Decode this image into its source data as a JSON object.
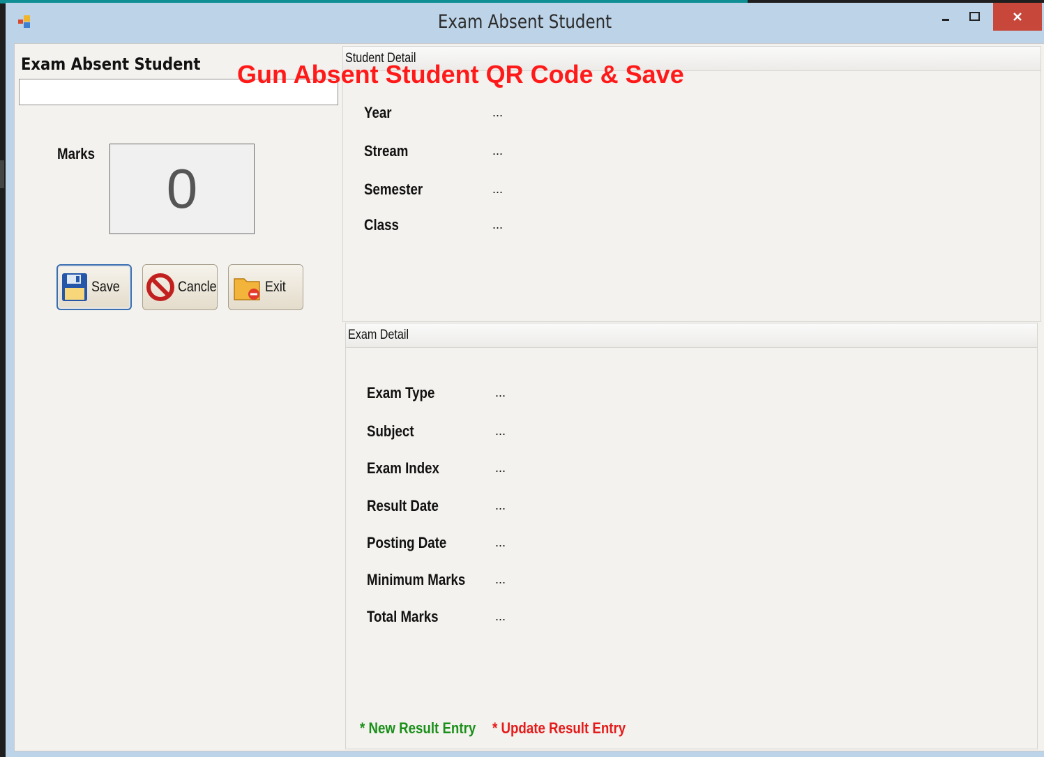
{
  "window": {
    "title": "Exam Absent Student"
  },
  "left": {
    "title": "Exam Absent Student",
    "qr_input_value": "",
    "marks_label": "Marks",
    "marks_value": "0",
    "buttons": {
      "save": "Save",
      "cancel": "Cancle",
      "exit": "Exit"
    }
  },
  "overlay_text": "Gun Absent Student QR Code & Save",
  "student_detail": {
    "header": "Student Detail",
    "rows": [
      {
        "label": "Year",
        "value": "..."
      },
      {
        "label": "Stream",
        "value": "..."
      },
      {
        "label": "Semester",
        "value": "..."
      },
      {
        "label": "Class",
        "value": "..."
      }
    ]
  },
  "exam_detail": {
    "header": "Exam Detail",
    "rows": [
      {
        "label": "Exam Type",
        "value": "..."
      },
      {
        "label": "Subject",
        "value": "..."
      },
      {
        "label": "Exam Index",
        "value": "..."
      },
      {
        "label": "Result Date",
        "value": "..."
      },
      {
        "label": "Posting Date",
        "value": "..."
      },
      {
        "label": "Minimum Marks",
        "value": "..."
      },
      {
        "label": "Total Marks",
        "value": "..."
      }
    ]
  },
  "legend": {
    "new": "* New Result Entry",
    "update": "* Update Result Entry"
  },
  "colors": {
    "overlay": "#ff1a1a",
    "new_entry": "#1a8f1a",
    "update_entry": "#e51b1b",
    "title_bar": "#bcd3e8",
    "close_button": "#c7473a"
  },
  "icons": {
    "app": "app-icon",
    "save": "floppy-disk-icon",
    "cancel": "no-entry-icon",
    "exit": "folder-exit-icon"
  }
}
